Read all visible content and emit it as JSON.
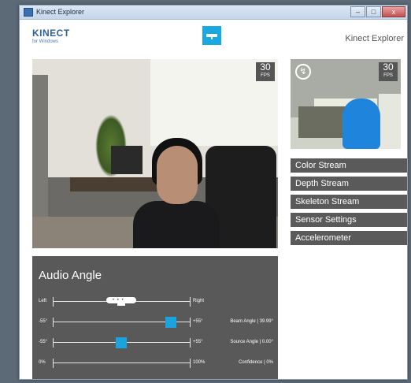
{
  "window": {
    "title": "Kinect Explorer",
    "controls": {
      "minimize": "–",
      "maximize": "□",
      "close": "x"
    }
  },
  "header": {
    "brand": "KINECT",
    "brand_sub": "for Windows",
    "app_name": "Kinect Explorer"
  },
  "color_view": {
    "fps": "30",
    "fps_unit": "FPS"
  },
  "depth_view": {
    "fps": "30",
    "fps_unit": "FPS",
    "mode_glyph": "↯",
    "person_color": "#1f84dc"
  },
  "menu": {
    "items": [
      {
        "label": "Color Stream"
      },
      {
        "label": "Depth Stream"
      },
      {
        "label": "Skeleton Stream"
      },
      {
        "label": "Sensor Settings"
      },
      {
        "label": "Accelerometer"
      }
    ]
  },
  "audio": {
    "title": "Audio Angle",
    "direction": {
      "left": "Left",
      "right": "Right"
    },
    "beam": {
      "min": "-55°",
      "max": "+55°",
      "label": "Beam Angle |",
      "value": "39.99°",
      "fraction": 0.86
    },
    "source": {
      "min": "-55°",
      "max": "+55°",
      "label": "Source Angle |",
      "value": "0.00°",
      "fraction": 0.5
    },
    "confidence": {
      "min": "0%",
      "max": "100%",
      "label": "Confidence |",
      "value": "0%",
      "fraction": 0
    }
  },
  "colors": {
    "accent": "#1aa8e0",
    "panel": "#595959",
    "menu": "#5a5a5a"
  }
}
